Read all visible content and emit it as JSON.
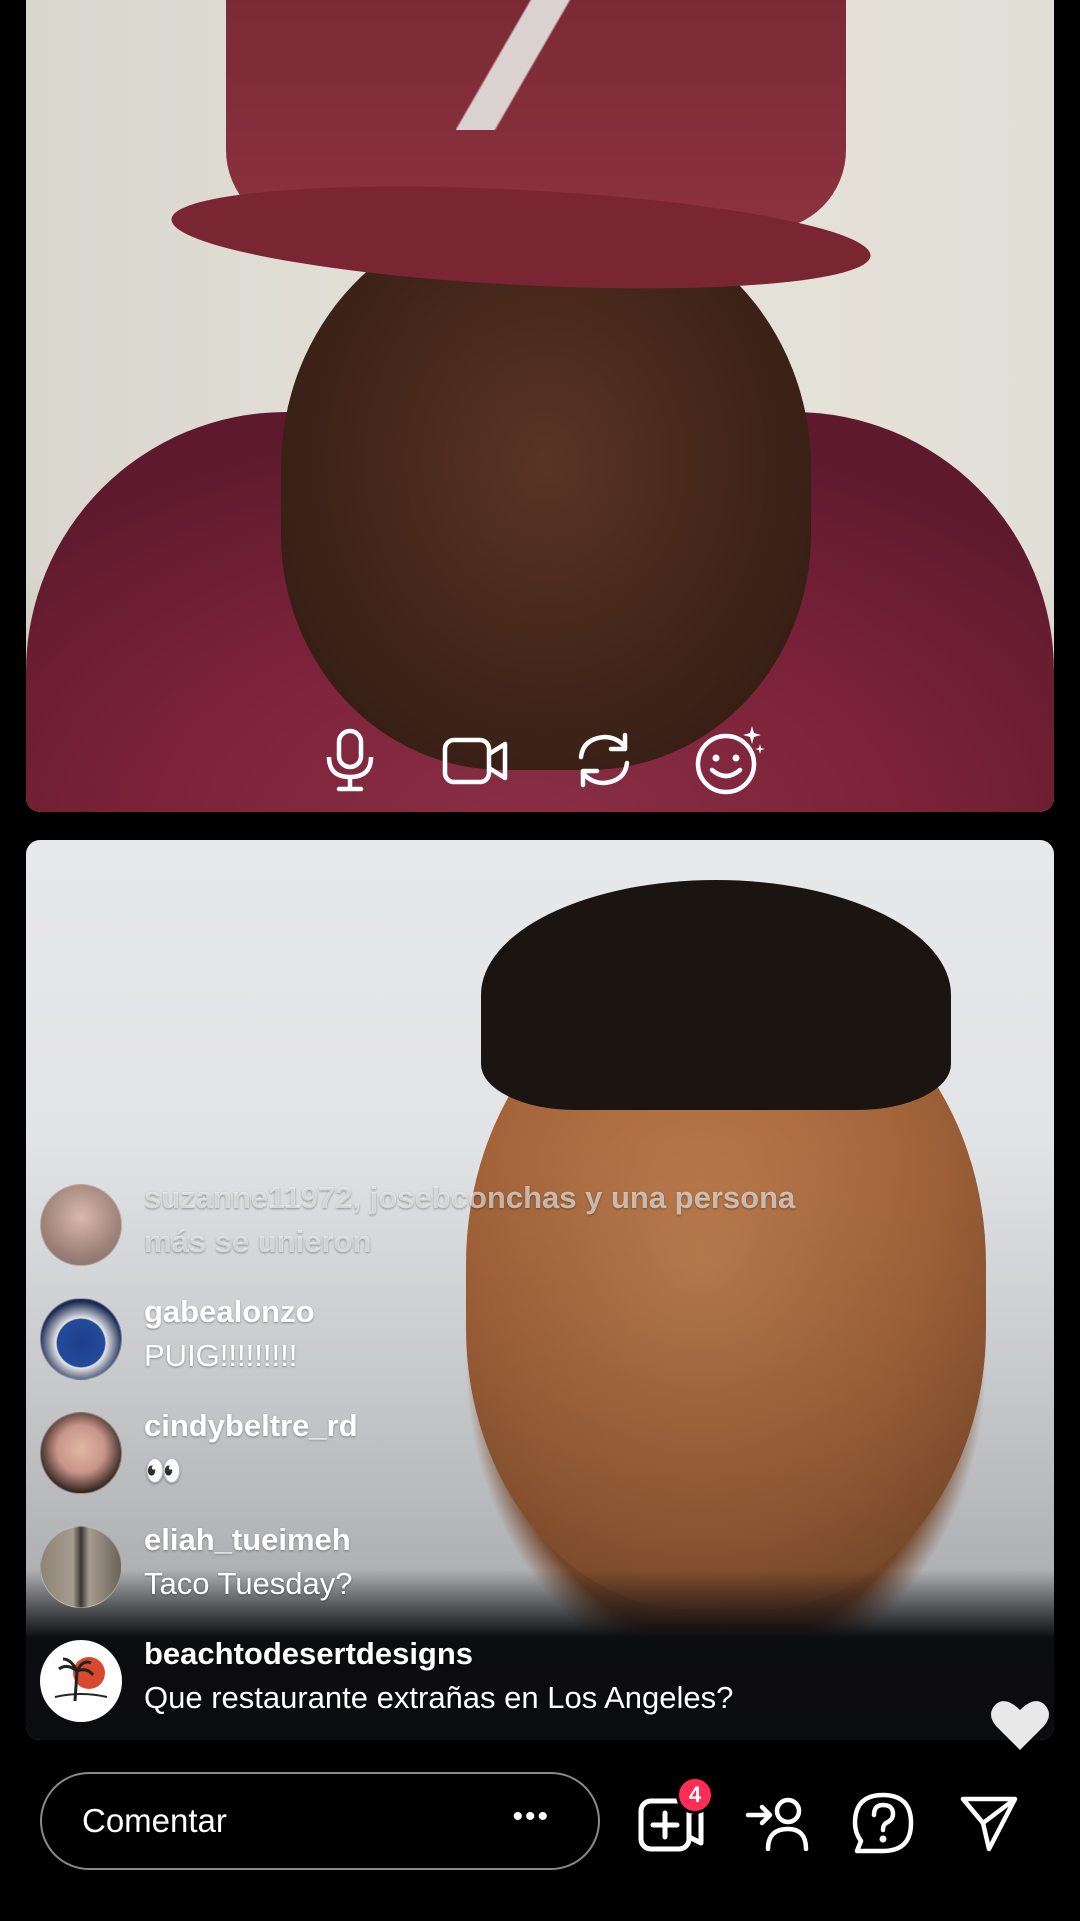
{
  "call_controls": {
    "items": [
      "microphone-icon",
      "video-camera-icon",
      "switch-camera-icon",
      "face-effects-icon"
    ]
  },
  "comments": [
    {
      "user": "suzanne11972, josebconchas y una persona",
      "text": "más se unieron",
      "faded": true
    },
    {
      "user": "gabealonzo",
      "text": "PUIG!!!!!!!!!"
    },
    {
      "user": "cindybeltre_rd",
      "text": "👀"
    },
    {
      "user": "eliah_tueimeh",
      "text": "Taco Tuesday?"
    },
    {
      "user": "beachtodesertdesigns",
      "text": "Que restaurante extrañas en Los Angeles?"
    }
  ],
  "comment_box": {
    "placeholder": "Comentar",
    "more": "•••"
  },
  "actions": {
    "add_guests_badge": "4",
    "icons": [
      "add-guest-icon",
      "request-join-icon",
      "questions-icon",
      "share-icon"
    ]
  },
  "colors": {
    "badge": "#ff2d55",
    "heart": "#e8e8e8"
  }
}
